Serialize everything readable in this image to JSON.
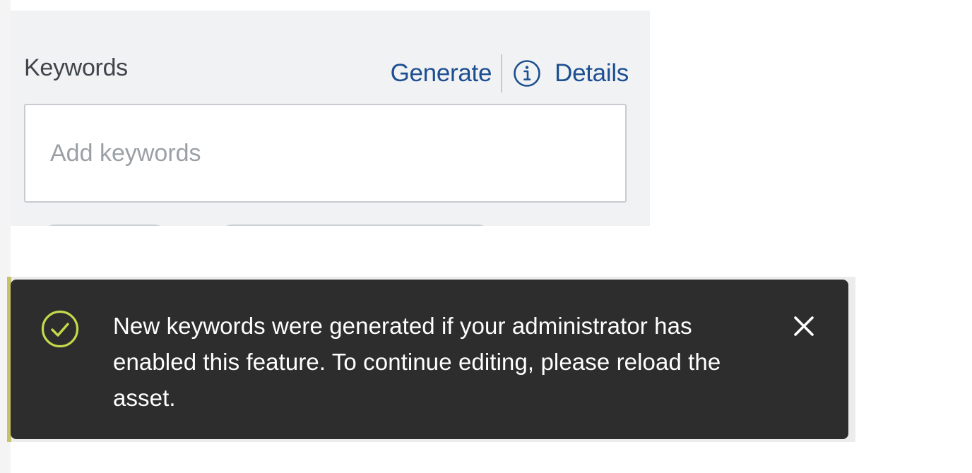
{
  "keywords_field": {
    "label": "Keywords",
    "generate_label": "Generate",
    "details_label": "Details",
    "info_icon": "info-circle-icon",
    "input_placeholder": "Add keywords",
    "input_value": ""
  },
  "toast": {
    "message": "New keywords were generated if your administrator has enabled this feature. To continue editing, please reload the asset.",
    "status_icon": "check-circle-icon",
    "close_icon": "close-icon"
  },
  "colors": {
    "link": "#1d4f91",
    "panel_background": "#f1f2f4",
    "toast_background": "#2d2d2d",
    "success_accent": "#c6d94a"
  }
}
